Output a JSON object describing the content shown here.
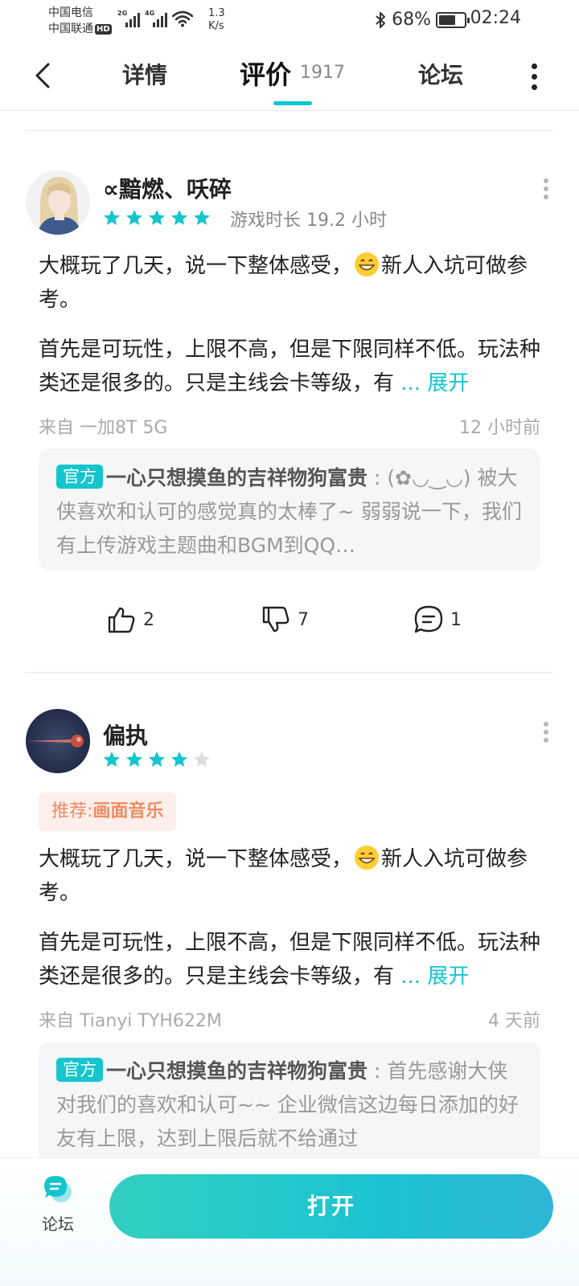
{
  "status_bar": {
    "carrier1": "中国电信",
    "carrier2": "中国联通",
    "hd": "HD",
    "sig1_label": "2G",
    "sig2_label": "4G",
    "speed_value": "1.3",
    "speed_unit": "K/s",
    "battery": "68%",
    "battery_level": 0.68,
    "time": "02:24"
  },
  "header": {
    "tabs": [
      {
        "label": "详情"
      },
      {
        "label": "评价",
        "count": "1917",
        "active": true
      },
      {
        "label": "论坛"
      }
    ]
  },
  "reviews": [
    {
      "username": "∝黯燃、㕭碎",
      "rating": 5,
      "playtime": "游戏时长 19.2 小时",
      "para1_a": "大概玩了几天，说一下整体感受，",
      "para1_emoji": "grinning-face",
      "para1_b": "新人入坑可做参考。",
      "para2": "首先是可玩性，上限不高，但是下限同样不低。玩法种类还是很多的。只是主线会卡等级，有",
      "expand": "... 展开",
      "source": "来自 一加8T 5G",
      "time": "12 小时前",
      "reply": {
        "badge": "官方",
        "name": "一心只想摸鱼的吉祥物狗富贵",
        "text": " : (✿◡‿◡) 被大侠喜欢和认可的感觉真的太棒了~ 弱弱说一下，我们有上传游戏主题曲和BGM到QQ…"
      },
      "likes": "2",
      "dislikes": "7",
      "comments": "1"
    },
    {
      "username": "偏执",
      "rating": 4,
      "recommend_label": "推荐:",
      "recommend_value": "画面音乐",
      "para1_a": "大概玩了几天，说一下整体感受，",
      "para1_emoji": "grinning-face",
      "para1_b": "新人入坑可做参考。",
      "para2": "首先是可玩性，上限不高，但是下限同样不低。玩法种类还是很多的。只是主线会卡等级，有",
      "expand": "... 展开",
      "source": "来自 Tianyi TYH622M",
      "time": "4 天前",
      "reply": {
        "badge": "官方",
        "name": "一心只想摸鱼的吉祥物狗富贵",
        "text": " : 首先感谢大侠对我们的喜欢和认可~~ 企业微信这边每日添加的好友有上限，达到上限后就不给通过"
      }
    }
  ],
  "bottom": {
    "forum_label": "论坛",
    "open_label": "打开"
  },
  "colors": {
    "accent": "#15c5ce",
    "recommend_text": "#f08a62",
    "recommend_bg": "#fdf0ec"
  }
}
